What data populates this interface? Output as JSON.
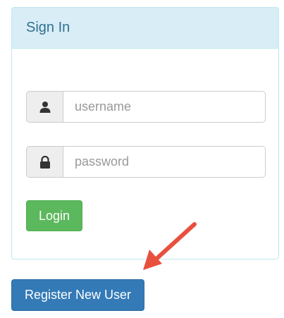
{
  "panel": {
    "title": "Sign In"
  },
  "form": {
    "username": {
      "placeholder": "username",
      "value": "",
      "icon": "user-icon"
    },
    "password": {
      "placeholder": "password",
      "value": "",
      "icon": "lock-icon"
    },
    "login_label": "Login"
  },
  "register_label": "Register New User",
  "colors": {
    "panel_heading_bg": "#d9edf7",
    "panel_border": "#bce8f1",
    "title_text": "#31708f",
    "login_button": "#5cb85c",
    "register_button": "#337ab7",
    "annotation_arrow": "#e8503e"
  }
}
